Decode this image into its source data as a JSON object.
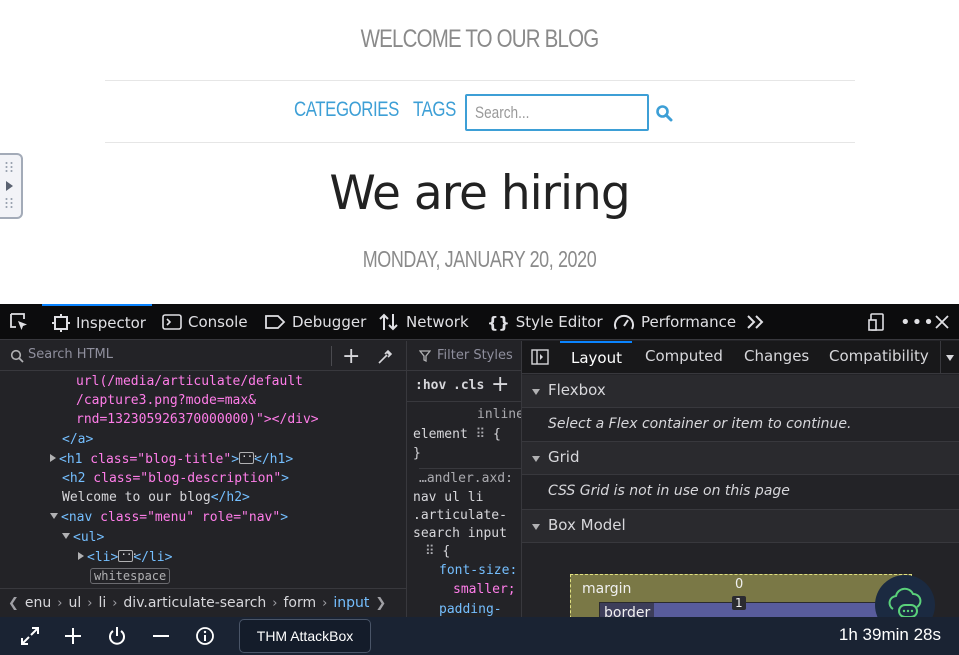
{
  "blog": {
    "title": "WELCOME TO OUR BLOG",
    "nav": {
      "categories": "CATEGORIES",
      "tags": "TAGS"
    },
    "search_placeholder": "Search...",
    "post_title": "We are hiring",
    "post_date": "MONDAY, JANUARY 20, 2020"
  },
  "devtools": {
    "tabs": [
      "Inspector",
      "Console",
      "Debugger",
      "Network",
      "Style Editor",
      "Performance"
    ],
    "search_html_placeholder": "Search HTML",
    "markup_lines": {
      "l1": "url(/media/articulate/default",
      "l2": "/capture3.png?mode=max&",
      "l3": "rnd=132305926370000000)\"></div>",
      "l4": "</a>",
      "h1_tag": "<h1",
      "h1_attr": " class=",
      "h1_val": "\"blog-title\"",
      "h1_close": "</h1>",
      "h2_tag": "<h2",
      "h2_attr": " class=",
      "h2_val": "\"blog-description\"",
      "h2_text": "Welcome to our blog",
      "h2_close": "</h2>",
      "nav_tag": "<nav",
      "nav_attr1": " class=",
      "nav_val1": "\"menu\"",
      "nav_attr2": " role=",
      "nav_val2": "\"nav\"",
      "ul_tag": "<ul>",
      "li_tag": "<li>",
      "li_close": "</li>",
      "whitespace": "whitespace"
    },
    "breadcrumbs": [
      "enu",
      "ul",
      "li",
      "div.articulate-search",
      "form",
      "input"
    ],
    "filter_styles_placeholder": "Filter Styles",
    "hov": ":hov",
    "cls": ".cls",
    "rules": {
      "inline": "inline",
      "element": "element",
      "brace_open": "{",
      "brace_close": "}",
      "source": "…andler.axd:",
      "sel1": "nav ul li",
      "sel2": ".articulate-",
      "sel3": "search input",
      "prop1": "font-size:",
      "val1": "smaller;",
      "prop2": "padding-"
    },
    "side_tabs": [
      "Layout",
      "Computed",
      "Changes",
      "Compatibility"
    ],
    "sections": {
      "flexbox": "Flexbox",
      "flexbox_note": "Select a Flex container or item to continue.",
      "grid": "Grid",
      "grid_note": "CSS Grid is not in use on this page",
      "box_model": "Box Model",
      "margin_label": "margin",
      "margin_value": "0",
      "border_label": "border",
      "border_value": "1"
    }
  },
  "bottom_bar": {
    "attackbox_label": "THM AttackBox",
    "timer": "1h 39min 28s"
  }
}
